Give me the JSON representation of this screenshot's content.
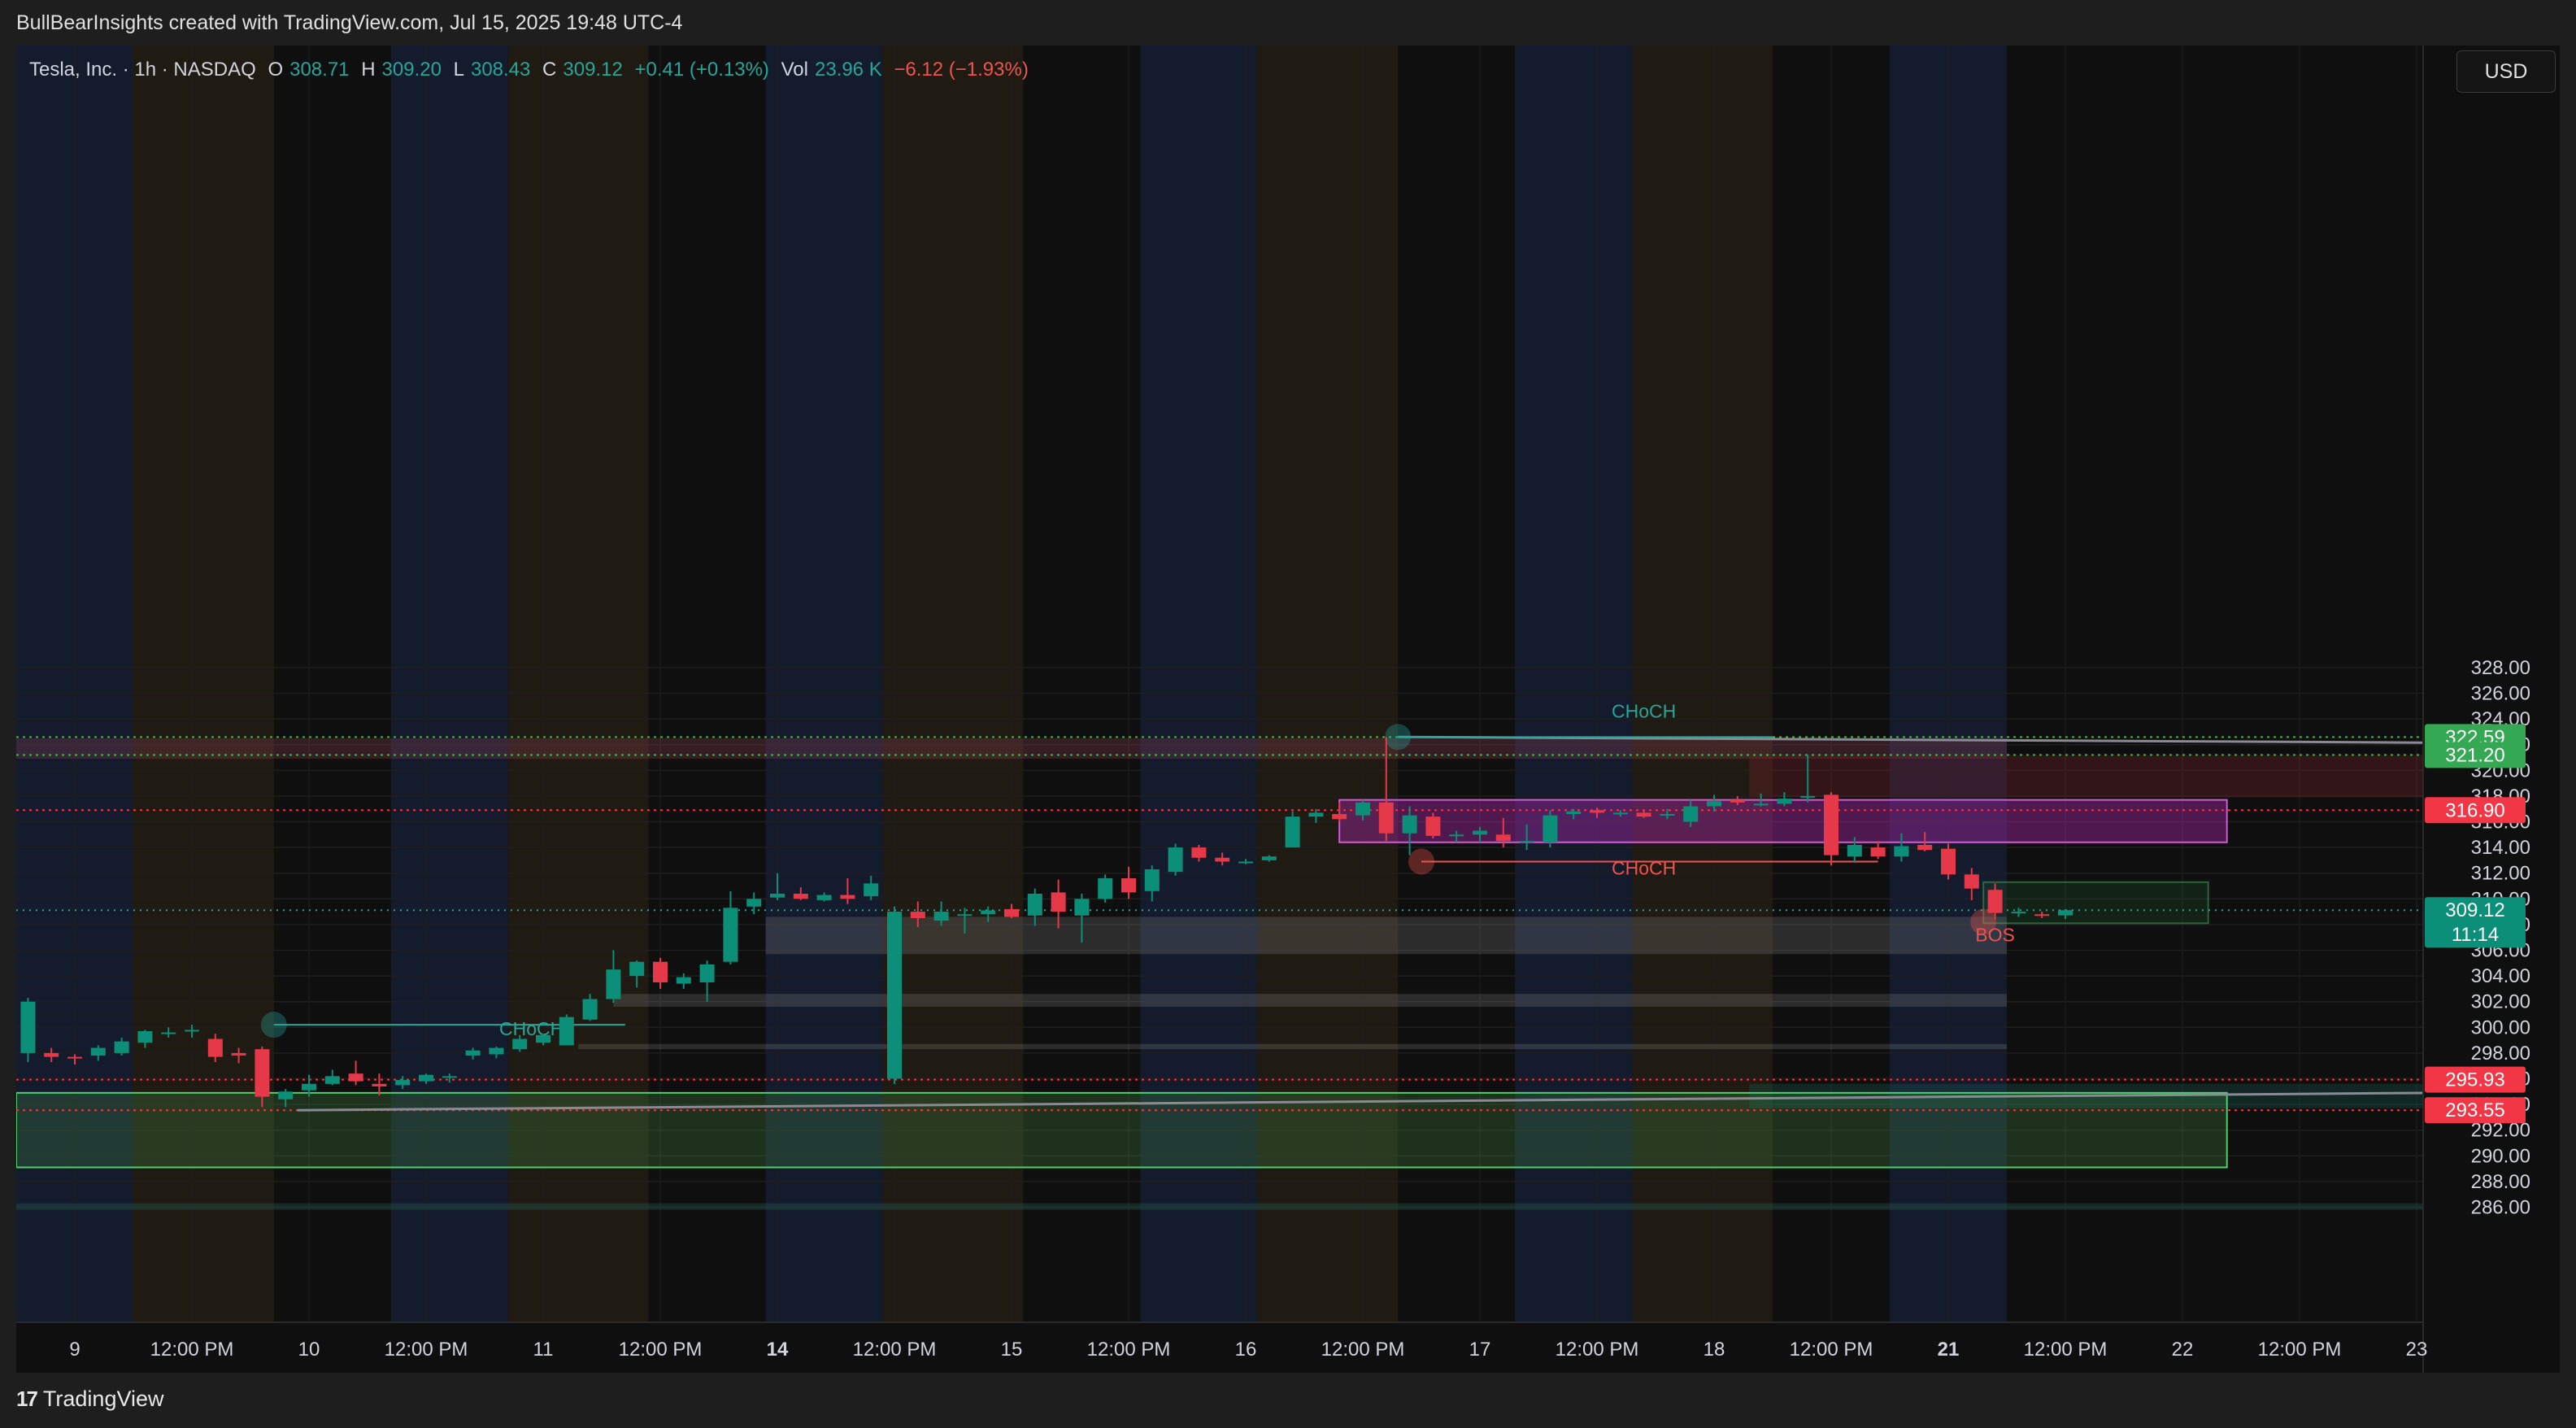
{
  "header": {
    "credit": "BullBearInsights created with TradingView.com, Jul 15, 2025 19:48 UTC-4"
  },
  "legend": {
    "symbol": "Tesla, Inc. · 1h · NASDAQ",
    "o_label": "O",
    "o_value": "308.71",
    "h_label": "H",
    "h_value": "309.20",
    "l_label": "L",
    "l_value": "308.43",
    "c_label": "C",
    "c_value": "309.12",
    "change": "+0.41 (+0.13%)",
    "vol_label": "Vol",
    "vol_value": "23.96 K",
    "vol_change": "−6.12 (−1.93%)"
  },
  "currency": "USD",
  "footer": {
    "brand": "TradingView"
  },
  "colors": {
    "background": "#0f0f0f",
    "bull": "#0b8f78",
    "bear": "#e53949",
    "green_tag": "#35a853",
    "red_tag": "#f23645",
    "teal_tag": "#0b8f78",
    "choch_bull": "#26a69a",
    "choch_bear": "#ef5350",
    "trendline": "#8a8a95"
  },
  "chart_data": {
    "type": "candlestick",
    "title": "Tesla, Inc. · 1h · NASDAQ",
    "y_ticks": [
      "286.00",
      "288.00",
      "290.00",
      "292.00",
      "294.00",
      "296.00",
      "298.00",
      "300.00",
      "302.00",
      "304.00",
      "306.00",
      "308.00",
      "310.00",
      "312.00",
      "314.00",
      "316.00",
      "318.00",
      "320.00",
      "322.00",
      "324.00",
      "326.00",
      "328.00"
    ],
    "ylim": [
      284.5,
      330.5
    ],
    "x_labels": [
      {
        "text": "9",
        "t": 2.5
      },
      {
        "text": "12:00 PM",
        "t": 7.5
      },
      {
        "text": "10",
        "t": 12.5
      },
      {
        "text": "12:00 PM",
        "t": 17.5
      },
      {
        "text": "11",
        "t": 22.5
      },
      {
        "text": "12:00 PM",
        "t": 27.5
      },
      {
        "text": "14",
        "t": 32.5
      },
      {
        "text": "12:00 PM",
        "t": 37.5
      },
      {
        "text": "15",
        "t": 42.5
      },
      {
        "text": "12:00 PM",
        "t": 47.5
      },
      {
        "text": "16",
        "t": 52.5
      },
      {
        "text": "12:00 PM",
        "t": 57.5
      },
      {
        "text": "17",
        "t": 62.5
      },
      {
        "text": "12:00 PM",
        "t": 67.5
      },
      {
        "text": "18",
        "t": 72.5
      },
      {
        "text": "12:00 PM",
        "t": 77.5
      },
      {
        "text": "21",
        "t": 82.5
      },
      {
        "text": "12:00 PM",
        "t": 87.5
      },
      {
        "text": "22",
        "t": 92.5
      },
      {
        "text": "12:00 PM",
        "t": 97.5
      },
      {
        "text": "23",
        "t": 102.5
      }
    ],
    "bold_x_labels": [
      "14",
      "21"
    ],
    "xlim": [
      0,
      103.5
    ],
    "candles": [
      {
        "o": 298.0,
        "h": 302.3,
        "l": 297.3,
        "c": 302.0
      },
      {
        "o": 298.0,
        "h": 298.4,
        "l": 297.3,
        "c": 297.7
      },
      {
        "o": 297.7,
        "h": 297.9,
        "l": 297.1,
        "c": 297.6
      },
      {
        "o": 297.8,
        "h": 298.6,
        "l": 297.4,
        "c": 298.4
      },
      {
        "o": 298.0,
        "h": 299.2,
        "l": 297.8,
        "c": 298.9
      },
      {
        "o": 298.8,
        "h": 299.8,
        "l": 298.4,
        "c": 299.7
      },
      {
        "o": 299.5,
        "h": 300.0,
        "l": 299.2,
        "c": 299.6
      },
      {
        "o": 299.7,
        "h": 300.2,
        "l": 299.2,
        "c": 299.8
      },
      {
        "o": 299.1,
        "h": 299.5,
        "l": 297.3,
        "c": 297.7
      },
      {
        "o": 298.0,
        "h": 298.4,
        "l": 297.2,
        "c": 297.8
      },
      {
        "o": 298.3,
        "h": 298.5,
        "l": 293.8,
        "c": 294.6
      },
      {
        "o": 294.4,
        "h": 295.2,
        "l": 293.8,
        "c": 295.0
      },
      {
        "o": 295.1,
        "h": 296.3,
        "l": 294.6,
        "c": 295.6
      },
      {
        "o": 295.6,
        "h": 296.7,
        "l": 295.5,
        "c": 296.2
      },
      {
        "o": 296.4,
        "h": 297.4,
        "l": 295.5,
        "c": 295.8
      },
      {
        "o": 295.6,
        "h": 296.4,
        "l": 294.7,
        "c": 295.4
      },
      {
        "o": 295.5,
        "h": 296.2,
        "l": 295.2,
        "c": 295.9
      },
      {
        "o": 295.8,
        "h": 296.4,
        "l": 295.6,
        "c": 296.3
      },
      {
        "o": 296.1,
        "h": 296.4,
        "l": 295.7,
        "c": 296.2
      },
      {
        "o": 297.8,
        "h": 298.4,
        "l": 297.5,
        "c": 298.2
      },
      {
        "o": 297.9,
        "h": 298.5,
        "l": 297.6,
        "c": 298.4
      },
      {
        "o": 298.3,
        "h": 299.4,
        "l": 298.1,
        "c": 299.1
      },
      {
        "o": 298.8,
        "h": 299.5,
        "l": 298.6,
        "c": 299.4
      },
      {
        "o": 298.6,
        "h": 301.0,
        "l": 298.6,
        "c": 300.8
      },
      {
        "o": 300.6,
        "h": 302.6,
        "l": 300.5,
        "c": 302.2
      },
      {
        "o": 302.2,
        "h": 306.0,
        "l": 301.9,
        "c": 304.5
      },
      {
        "o": 304.0,
        "h": 305.2,
        "l": 303.1,
        "c": 305.1
      },
      {
        "o": 305.1,
        "h": 305.4,
        "l": 303.0,
        "c": 303.5
      },
      {
        "o": 303.4,
        "h": 304.2,
        "l": 303.0,
        "c": 303.9
      },
      {
        "o": 303.5,
        "h": 305.2,
        "l": 302.0,
        "c": 304.9
      },
      {
        "o": 305.1,
        "h": 310.6,
        "l": 304.9,
        "c": 309.3
      },
      {
        "o": 309.4,
        "h": 310.5,
        "l": 308.8,
        "c": 310.0
      },
      {
        "o": 310.1,
        "h": 312.0,
        "l": 309.9,
        "c": 310.4
      },
      {
        "o": 310.4,
        "h": 310.9,
        "l": 309.9,
        "c": 310.0
      },
      {
        "o": 309.9,
        "h": 310.5,
        "l": 309.8,
        "c": 310.3
      },
      {
        "o": 310.3,
        "h": 311.6,
        "l": 309.6,
        "c": 310.0
      },
      {
        "o": 310.2,
        "h": 311.8,
        "l": 309.9,
        "c": 311.2
      },
      {
        "o": 296.0,
        "h": 309.4,
        "l": 295.6,
        "c": 309.0
      },
      {
        "o": 309.0,
        "h": 309.8,
        "l": 307.8,
        "c": 308.5
      },
      {
        "o": 308.3,
        "h": 309.8,
        "l": 307.9,
        "c": 309.0
      },
      {
        "o": 308.7,
        "h": 309.3,
        "l": 307.3,
        "c": 308.8
      },
      {
        "o": 308.8,
        "h": 309.4,
        "l": 308.2,
        "c": 309.1
      },
      {
        "o": 309.2,
        "h": 309.6,
        "l": 308.5,
        "c": 308.6
      },
      {
        "o": 308.7,
        "h": 310.8,
        "l": 307.9,
        "c": 310.4
      },
      {
        "o": 310.5,
        "h": 311.5,
        "l": 307.7,
        "c": 309.0
      },
      {
        "o": 308.7,
        "h": 310.4,
        "l": 306.6,
        "c": 310.0
      },
      {
        "o": 310.0,
        "h": 311.9,
        "l": 309.7,
        "c": 311.6
      },
      {
        "o": 311.6,
        "h": 312.5,
        "l": 310.0,
        "c": 310.5
      },
      {
        "o": 310.6,
        "h": 312.6,
        "l": 309.8,
        "c": 312.3
      },
      {
        "o": 312.1,
        "h": 314.3,
        "l": 311.8,
        "c": 314.0
      },
      {
        "o": 314.0,
        "h": 314.2,
        "l": 312.9,
        "c": 313.2
      },
      {
        "o": 313.2,
        "h": 313.6,
        "l": 312.6,
        "c": 312.9
      },
      {
        "o": 312.8,
        "h": 313.1,
        "l": 312.7,
        "c": 312.9
      },
      {
        "o": 313.0,
        "h": 313.4,
        "l": 312.9,
        "c": 313.3
      },
      {
        "o": 314.0,
        "h": 316.8,
        "l": 314.0,
        "c": 316.4
      },
      {
        "o": 316.4,
        "h": 317.0,
        "l": 315.9,
        "c": 316.7
      },
      {
        "o": 316.6,
        "h": 317.5,
        "l": 316.0,
        "c": 316.2
      },
      {
        "o": 316.5,
        "h": 317.7,
        "l": 316.1,
        "c": 317.5
      },
      {
        "o": 317.5,
        "h": 322.6,
        "l": 314.5,
        "c": 315.1
      },
      {
        "o": 315.1,
        "h": 317.2,
        "l": 313.4,
        "c": 316.5
      },
      {
        "o": 316.4,
        "h": 316.7,
        "l": 314.7,
        "c": 314.9
      },
      {
        "o": 314.9,
        "h": 315.3,
        "l": 314.4,
        "c": 315.0
      },
      {
        "o": 315.0,
        "h": 315.6,
        "l": 314.4,
        "c": 315.3
      },
      {
        "o": 315.0,
        "h": 316.3,
        "l": 314.0,
        "c": 314.5
      },
      {
        "o": 314.5,
        "h": 315.8,
        "l": 313.8,
        "c": 314.5
      },
      {
        "o": 314.4,
        "h": 316.9,
        "l": 314.0,
        "c": 316.5
      },
      {
        "o": 316.6,
        "h": 317.0,
        "l": 316.2,
        "c": 316.8
      },
      {
        "o": 316.9,
        "h": 317.1,
        "l": 316.3,
        "c": 316.7
      },
      {
        "o": 316.6,
        "h": 316.9,
        "l": 316.4,
        "c": 316.7
      },
      {
        "o": 316.7,
        "h": 316.9,
        "l": 316.3,
        "c": 316.4
      },
      {
        "o": 316.5,
        "h": 317.0,
        "l": 316.2,
        "c": 316.6
      },
      {
        "o": 316.0,
        "h": 317.7,
        "l": 315.6,
        "c": 317.2
      },
      {
        "o": 317.2,
        "h": 318.1,
        "l": 316.8,
        "c": 317.6
      },
      {
        "o": 317.7,
        "h": 318.0,
        "l": 317.3,
        "c": 317.5
      },
      {
        "o": 317.4,
        "h": 318.2,
        "l": 317.2,
        "c": 317.4
      },
      {
        "o": 317.4,
        "h": 318.3,
        "l": 317.2,
        "c": 317.8
      },
      {
        "o": 317.9,
        "h": 321.2,
        "l": 317.5,
        "c": 318.0
      },
      {
        "o": 318.1,
        "h": 318.3,
        "l": 312.6,
        "c": 313.4
      },
      {
        "o": 313.3,
        "h": 314.8,
        "l": 312.8,
        "c": 314.2
      },
      {
        "o": 314.0,
        "h": 314.5,
        "l": 313.1,
        "c": 313.3
      },
      {
        "o": 313.3,
        "h": 315.1,
        "l": 312.9,
        "c": 314.1
      },
      {
        "o": 314.2,
        "h": 315.2,
        "l": 313.7,
        "c": 313.8
      },
      {
        "o": 313.9,
        "h": 314.3,
        "l": 311.5,
        "c": 311.9
      },
      {
        "o": 311.9,
        "h": 312.4,
        "l": 309.9,
        "c": 310.8
      },
      {
        "o": 310.7,
        "h": 311.2,
        "l": 308.4,
        "c": 308.9
      },
      {
        "o": 308.9,
        "h": 309.3,
        "l": 308.6,
        "c": 309.0
      },
      {
        "o": 308.8,
        "h": 309.0,
        "l": 308.5,
        "c": 308.7
      },
      {
        "o": 308.71,
        "h": 309.2,
        "l": 308.43,
        "c": 309.12
      }
    ],
    "session_bands": [
      {
        "from": 0,
        "to": 5,
        "type": "pre"
      },
      {
        "from": 5,
        "to": 11,
        "type": "post"
      },
      {
        "from": 16,
        "to": 21,
        "type": "pre"
      },
      {
        "from": 21,
        "to": 27,
        "type": "post"
      },
      {
        "from": 32,
        "to": 37,
        "type": "pre"
      },
      {
        "from": 37,
        "to": 43,
        "type": "post"
      },
      {
        "from": 48,
        "to": 53,
        "type": "pre"
      },
      {
        "from": 53,
        "to": 59,
        "type": "post"
      },
      {
        "from": 64,
        "to": 69,
        "type": "pre"
      },
      {
        "from": 69,
        "to": 75,
        "type": "post"
      },
      {
        "from": 80,
        "to": 85,
        "type": "pre"
      }
    ],
    "zones": [
      {
        "t0": 0,
        "t1": 85,
        "y0": 320.9,
        "y1": 322.5,
        "type": "supply_thin"
      },
      {
        "t0": 74,
        "t1": 1000,
        "y0": 317.9,
        "y1": 321.2,
        "type": "supply"
      },
      {
        "t0": 56.5,
        "t1": 94.4,
        "y0": 314.4,
        "y1": 317.7,
        "type": "pink"
      },
      {
        "t0": 84,
        "t1": 93.6,
        "y0": 308.1,
        "y1": 311.3,
        "type": "green_small"
      },
      {
        "t0": 32,
        "t1": 85,
        "y0": 305.7,
        "y1": 308.6,
        "type": "gray"
      },
      {
        "t0": 25.5,
        "t1": 85,
        "y0": 301.6,
        "y1": 302.6,
        "type": "gray"
      },
      {
        "t0": 24,
        "t1": 85,
        "y0": 298.3,
        "y1": 298.7,
        "type": "gray"
      },
      {
        "t0": 74,
        "t1": 1000,
        "y0": 293.7,
        "y1": 295.6,
        "type": "teal"
      },
      {
        "t0": 0,
        "t1": 94.4,
        "y0": 289.1,
        "y1": 294.9,
        "type": "demand"
      },
      {
        "t0": 0,
        "t1": 1000,
        "y0": 285.8,
        "y1": 286.3,
        "type": "teal_thin"
      }
    ],
    "horizontal_levels": [
      {
        "price": 322.59,
        "label": "322.59",
        "color": "green"
      },
      {
        "price": 321.2,
        "label": "321.20",
        "color": "green"
      },
      {
        "price": 316.9,
        "label": "316.90",
        "color": "red"
      },
      {
        "price": 309.12,
        "label": "309.12",
        "color": "teal_current",
        "countdown": "11:14"
      },
      {
        "price": 295.93,
        "label": "295.93",
        "color": "red"
      },
      {
        "price": 293.55,
        "label": "293.55",
        "color": "red"
      }
    ],
    "trendlines": [
      {
        "t0": 59,
        "p0": 322.6,
        "t1": 1000,
        "p1": 313.1
      },
      {
        "t0": 12,
        "p0": 293.55,
        "t1": 1000,
        "p1": 308.2
      }
    ],
    "structure_labels": [
      {
        "text": "CHoCH",
        "type": "bull",
        "t": 69.5,
        "price": 324.1,
        "line": {
          "t0": 59,
          "t1": 75,
          "price": 322.59
        }
      },
      {
        "text": "CHoCH",
        "type": "bear",
        "t": 69.5,
        "price": 311.9,
        "line": {
          "t0": 60,
          "t1": 79.5,
          "price": 312.9
        }
      },
      {
        "text": "CHoCH",
        "type": "bull",
        "t": 22,
        "price": 299.4,
        "line": {
          "t0": 11,
          "t1": 26,
          "price": 300.2
        }
      },
      {
        "text": "BOS",
        "type": "bear",
        "t": 84.5,
        "price": 306.7,
        "line": null
      }
    ],
    "markers": [
      {
        "t": 59,
        "price": 322.6,
        "type": "bull"
      },
      {
        "t": 60,
        "price": 312.9,
        "type": "bear"
      },
      {
        "t": 11,
        "price": 300.2,
        "type": "bull"
      },
      {
        "t": 84,
        "price": 308.2,
        "type": "bear"
      }
    ]
  }
}
